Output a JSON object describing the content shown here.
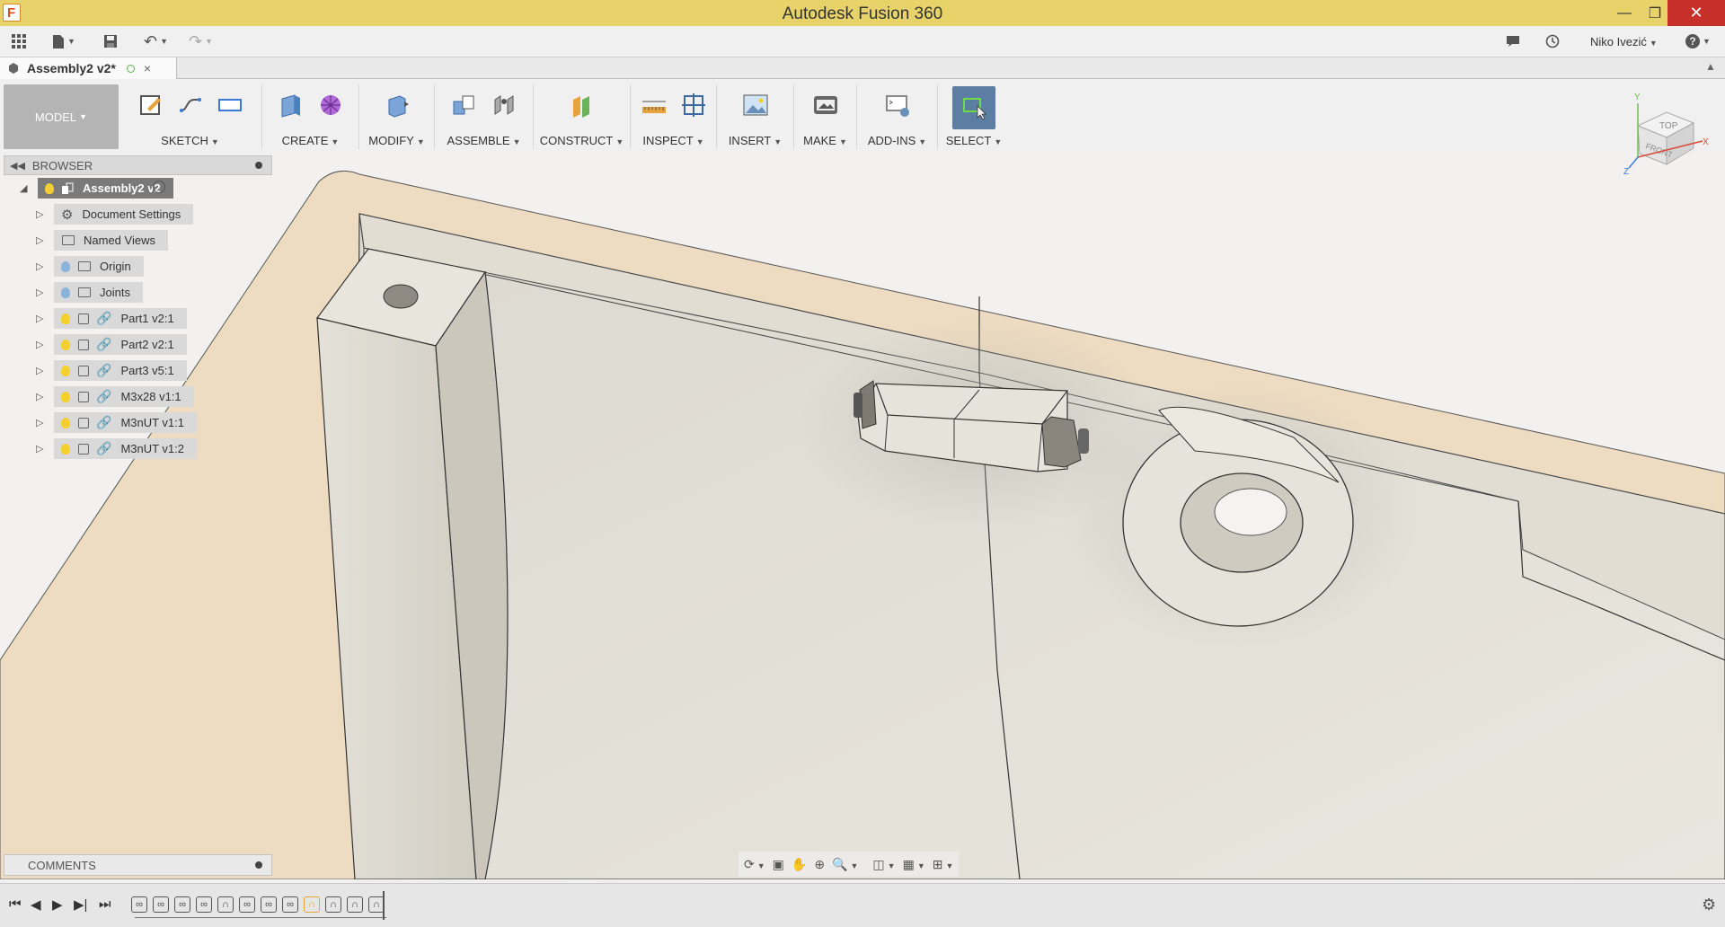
{
  "window": {
    "title": "Autodesk Fusion 360"
  },
  "quick_access": {
    "user_name": "Niko Ivezić",
    "help_label": "?"
  },
  "document_tab": {
    "label": "Assembly2 v2*",
    "close": "×"
  },
  "workspace": {
    "label": "MODEL"
  },
  "toolbar_groups": [
    {
      "label": "SKETCH"
    },
    {
      "label": "CREATE"
    },
    {
      "label": "MODIFY"
    },
    {
      "label": "ASSEMBLE"
    },
    {
      "label": "CONSTRUCT"
    },
    {
      "label": "INSPECT"
    },
    {
      "label": "INSERT"
    },
    {
      "label": "MAKE"
    },
    {
      "label": "ADD-INS"
    },
    {
      "label": "SELECT"
    }
  ],
  "browser": {
    "header": "BROWSER",
    "root": "Assembly2 v2",
    "items": [
      {
        "label": "Document Settings"
      },
      {
        "label": "Named Views"
      },
      {
        "label": "Origin"
      },
      {
        "label": "Joints"
      },
      {
        "label": "Part1 v2:1"
      },
      {
        "label": "Part2 v2:1"
      },
      {
        "label": "Part3 v5:1"
      },
      {
        "label": "M3x28 v1:1"
      },
      {
        "label": "M3nUT v1:1"
      },
      {
        "label": "M3nUT v1:2"
      }
    ]
  },
  "comments": {
    "label": "COMMENTS"
  },
  "viewcube": {
    "top": "TOP",
    "front": "FRONT",
    "axis_x": "X",
    "axis_y": "Y",
    "axis_z": "Z"
  },
  "colors": {
    "title_bar": "#e8d36a",
    "close_button": "#c7302a",
    "part_face": "#e6e3db",
    "part_edge": "#f0dcc2"
  }
}
